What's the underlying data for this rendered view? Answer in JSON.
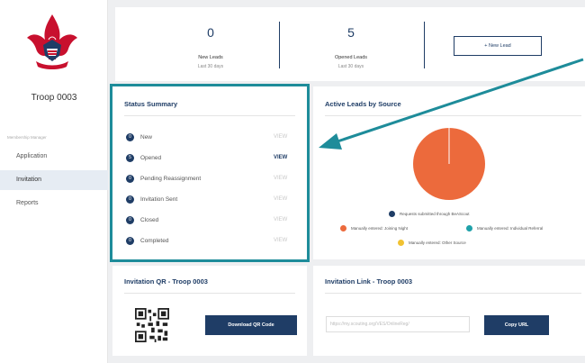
{
  "sidebar": {
    "troop_name": "Troop 0003",
    "section_label": "Membership Manager",
    "items": [
      {
        "label": "Application"
      },
      {
        "label": "Invitation"
      },
      {
        "label": "Reports"
      }
    ]
  },
  "stats": {
    "new_leads": {
      "value": "0",
      "label": "New Leads",
      "period": "Last 30 days"
    },
    "opened_leads": {
      "value": "5",
      "label": "Opened Leads",
      "period": "Last 30 days"
    },
    "new_lead_button": "+ New Lead"
  },
  "status_summary": {
    "title": "Status Summary",
    "rows": [
      {
        "count": "0",
        "label": "New",
        "action": "VIEW"
      },
      {
        "count": "5",
        "label": "Opened",
        "action": "VIEW"
      },
      {
        "count": "0",
        "label": "Pending Reassignment",
        "action": "VIEW"
      },
      {
        "count": "0",
        "label": "Invitation Sent",
        "action": "VIEW"
      },
      {
        "count": "0",
        "label": "Closed",
        "action": "VIEW"
      },
      {
        "count": "0",
        "label": "Completed",
        "action": "VIEW"
      }
    ]
  },
  "chart_data": {
    "type": "pie",
    "title": "Active Leads by Source",
    "categories": [
      "Requests submitted through BeAScout",
      "Manually entered: Joining Night",
      "Manually entered: Individual Referral",
      "Manually entered: Other Source"
    ],
    "values": [
      0,
      5,
      0,
      0
    ],
    "colors": [
      "#1f3d66",
      "#ec6a3c",
      "#1fa1a9",
      "#f1c232"
    ],
    "legend_position": "bottom"
  },
  "qr": {
    "title": "Invitation QR - Troop 0003",
    "button": "Download QR Code"
  },
  "invite_link": {
    "title": "Invitation Link - Troop 0003",
    "url": "https://my.scouting.org/VES/OnlineReg/",
    "button": "Copy URL"
  }
}
